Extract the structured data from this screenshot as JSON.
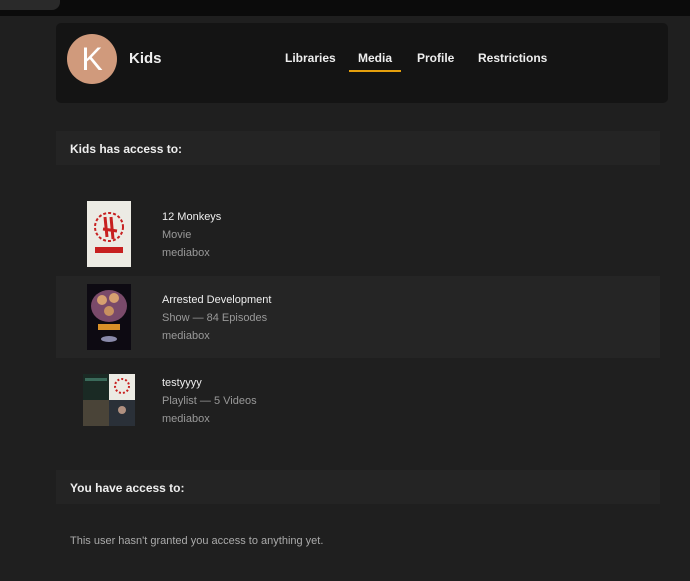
{
  "user": {
    "initial": "K",
    "name": "Kids"
  },
  "tabs": [
    {
      "label": "Libraries"
    },
    {
      "label": "Media",
      "active": true
    },
    {
      "label": "Profile"
    },
    {
      "label": "Restrictions"
    }
  ],
  "kids_access": {
    "heading": "Kids has access to:",
    "items": [
      {
        "title": "12 Monkeys",
        "type": "Movie",
        "server": "mediabox"
      },
      {
        "title": "Arrested Development",
        "type": "Show — 84 Episodes",
        "server": "mediabox"
      },
      {
        "title": "testyyyy",
        "type": "Playlist — 5 Videos",
        "server": "mediabox"
      }
    ]
  },
  "your_access": {
    "heading": "You have access to:",
    "empty_message": "This user hasn't granted you access to anything yet."
  },
  "colors": {
    "accent": "#e5a00d",
    "avatar": "#d09a7c"
  }
}
